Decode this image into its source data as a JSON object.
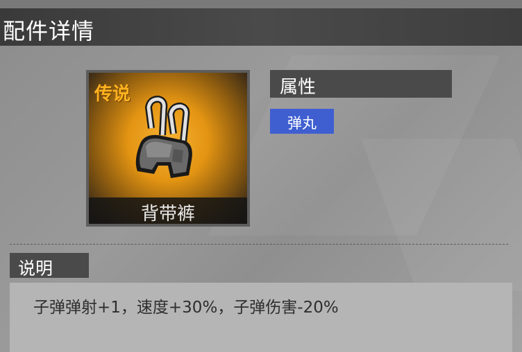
{
  "header": {
    "title": "配件详情"
  },
  "item": {
    "rarity": "传说",
    "name": "背带裤",
    "icon": "overalls-icon",
    "rarity_color": "#ffb320"
  },
  "attributes": {
    "label": "属性",
    "tags": [
      "弹丸"
    ],
    "tag_color": "#3f5fd1"
  },
  "description": {
    "label": "说明",
    "text": "子弹弹射+1，速度+30%，子弹伤害-20%"
  }
}
